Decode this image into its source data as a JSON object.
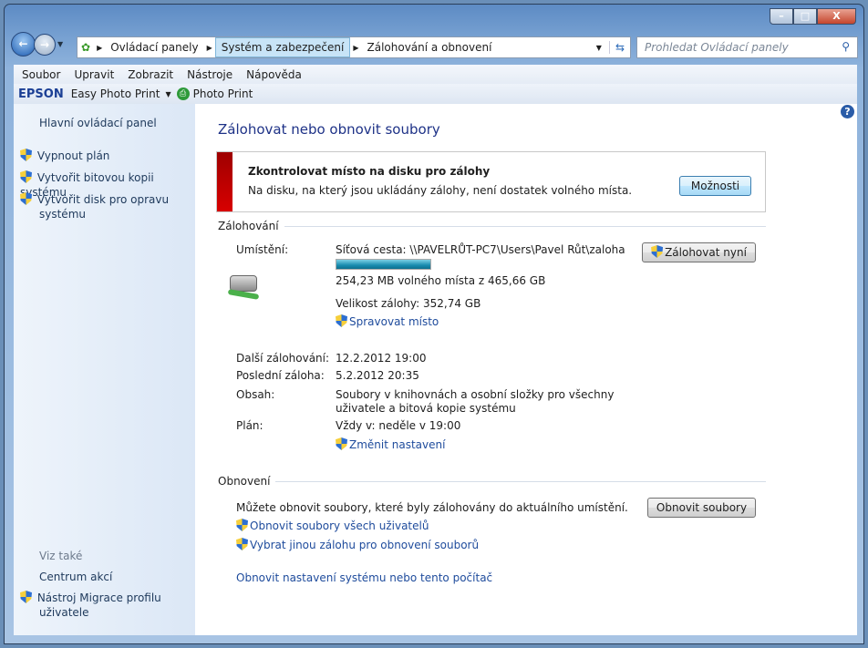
{
  "window": {
    "minimize": "–",
    "maximize": "□",
    "close": "X"
  },
  "address": {
    "crumbs": [
      "Ovládací panely",
      "Systém a zabezpečení",
      "Zálohování a obnovení"
    ],
    "search_placeholder": "Prohledat Ovládací panely"
  },
  "menu": [
    "Soubor",
    "Upravit",
    "Zobrazit",
    "Nástroje",
    "Nápověda"
  ],
  "toolbar": {
    "brand": "EPSON",
    "easy_photo_print": "Easy Photo Print",
    "photo_print": "Photo Print"
  },
  "sidebar": {
    "home": "Hlavní ovládací panel",
    "items": [
      "Vypnout plán",
      "Vytvořit bitovou kopii systému",
      "Vytvořit disk pro opravu systému"
    ],
    "see_also": "Viz také",
    "see_also_items": [
      "Centrum akcí",
      "Nástroj Migrace profilu uživatele"
    ]
  },
  "main": {
    "title": "Zálohovat nebo obnovit soubory",
    "alert": {
      "title": "Zkontrolovat místo na disku pro zálohy",
      "text": "Na disku, na který jsou ukládány zálohy, není dostatek volného místa.",
      "button": "Možnosti"
    },
    "backup": {
      "heading": "Zálohování",
      "location_label": "Umístění:",
      "location": "Síťová cesta: \\\\PAVELRŮT-PC7\\Users\\Pavel Růt\\zaloha",
      "used_percent": 99.95,
      "free": "254,23 MB volného místa z 465,66 GB",
      "size": "Velikost zálohy: 352,74 GB",
      "manage": "Spravovat místo",
      "backup_now": "Zálohovat nyní",
      "next_label": "Další zálohování:",
      "next": "12.2.2012 19:00",
      "last_label": "Poslední záloha:",
      "last": "5.2.2012 20:35",
      "contents_label": "Obsah:",
      "contents": "Soubory v knihovnách a osobní složky pro všechny uživatele a bitová kopie systému",
      "schedule_label": "Plán:",
      "schedule": "Vždy v: neděle v 19:00",
      "change": "Změnit nastavení"
    },
    "restore": {
      "heading": "Obnovení",
      "text": "Můžete obnovit soubory, které byly zálohovány do aktuálního umístění.",
      "button": "Obnovit soubory",
      "all_users": "Obnovit soubory všech uživatelů",
      "other": "Vybrat jinou zálohu pro obnovení souborů",
      "system": "Obnovit nastavení systému nebo tento počítač"
    },
    "help": "?"
  }
}
